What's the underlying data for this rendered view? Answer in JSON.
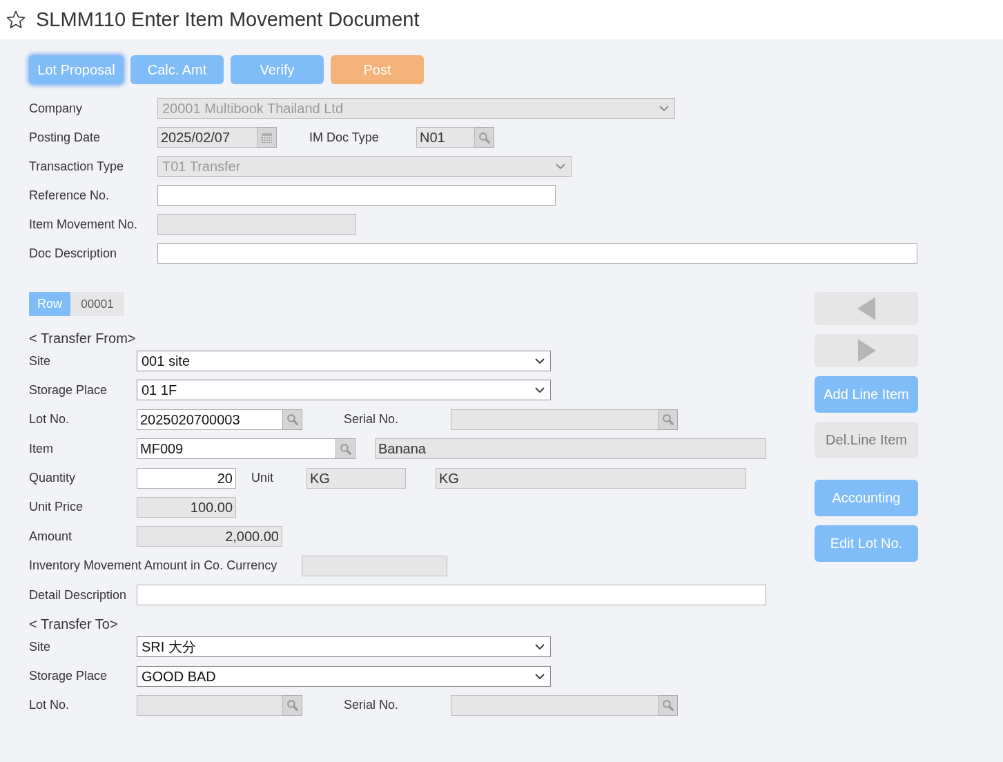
{
  "page": {
    "title": "SLMM110 Enter Item Movement Document",
    "favorite": false
  },
  "toolbar": [
    {
      "label": "Lot Proposal",
      "kind": "primary",
      "focused": true
    },
    {
      "label": "Calc. Amt",
      "kind": "primary",
      "focused": false
    },
    {
      "label": "Verify",
      "kind": "primary",
      "focused": false
    },
    {
      "label": "Post",
      "kind": "post",
      "focused": false
    }
  ],
  "header": {
    "company": {
      "label": "Company",
      "value": "20001 Multibook Thailand Ltd",
      "disabled": true
    },
    "posting_date": {
      "label": "Posting Date",
      "value": "2025/02/07",
      "disabled": true
    },
    "im_doc_type": {
      "label": "IM Doc Type",
      "value": "N01",
      "disabled": true
    },
    "transaction_type": {
      "label": "Transaction Type",
      "value": "T01 Transfer",
      "disabled": true
    },
    "reference_no": {
      "label": "Reference No.",
      "disabled": false
    },
    "item_movement_no": {
      "label": "Item Movement No.",
      "disabled": true
    },
    "doc_description": {
      "label": "Doc Description",
      "disabled": false
    }
  },
  "row": {
    "label": "Row",
    "value": "00001"
  },
  "transfer_from": {
    "heading": "< Transfer From>",
    "site": {
      "label": "Site",
      "value": "001 site",
      "disabled": false
    },
    "storage_place": {
      "label": "Storage Place",
      "value": "01 1F",
      "disabled": false
    },
    "lot_no": {
      "label": "Lot No.",
      "value": "2025020700003",
      "disabled": false
    },
    "serial_no": {
      "label": "Serial No.",
      "disabled": true
    },
    "item": {
      "label": "Item",
      "value": "MF009",
      "disabled": false
    },
    "item_name": {
      "value": "Banana",
      "disabled": true
    },
    "quantity": {
      "label": "Quantity",
      "value": "20",
      "disabled": false
    },
    "unit": {
      "label": "Unit",
      "value": "KG",
      "disabled": true
    },
    "unit_name": {
      "value": "KG",
      "disabled": true
    },
    "unit_price": {
      "label": "Unit Price",
      "value": "100.00",
      "disabled": true
    },
    "amount": {
      "label": "Amount",
      "value": "2,000.00",
      "disabled": true
    },
    "co_currency_amount": {
      "label": "Inventory Movement Amount in Co. Currency",
      "disabled": true
    },
    "detail_description": {
      "label": "Detail Description",
      "disabled": false
    }
  },
  "transfer_to": {
    "heading": "< Transfer To>",
    "site": {
      "label": "Site",
      "value": "SRI 大分",
      "disabled": false
    },
    "storage_place": {
      "label": "Storage Place",
      "value": "GOOD BAD",
      "disabled": false
    },
    "lot_no": {
      "label": "Lot No.",
      "disabled": true
    },
    "serial_no": {
      "label": "Serial No.",
      "disabled": true
    }
  },
  "side_buttons": [
    {
      "kind": "prev",
      "disabled": true
    },
    {
      "kind": "next",
      "disabled": true
    },
    {
      "kind": "text",
      "label": "Add Line Item",
      "disabled": false
    },
    {
      "kind": "text",
      "label": "Del.Line Item",
      "disabled": true
    },
    {
      "kind": "text",
      "label": "Accounting",
      "disabled": false
    },
    {
      "kind": "text",
      "label": "Edit Lot No.",
      "disabled": false
    }
  ]
}
